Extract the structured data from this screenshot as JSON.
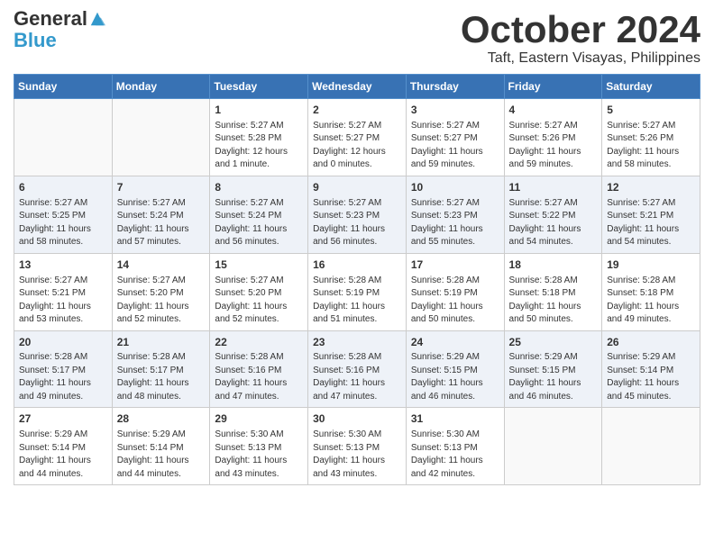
{
  "header": {
    "logo_general": "General",
    "logo_blue": "Blue",
    "month_title": "October 2024",
    "location": "Taft, Eastern Visayas, Philippines"
  },
  "days_of_week": [
    "Sunday",
    "Monday",
    "Tuesday",
    "Wednesday",
    "Thursday",
    "Friday",
    "Saturday"
  ],
  "weeks": [
    [
      {
        "day": "",
        "detail": ""
      },
      {
        "day": "",
        "detail": ""
      },
      {
        "day": "1",
        "detail": "Sunrise: 5:27 AM\nSunset: 5:28 PM\nDaylight: 12 hours\nand 1 minute."
      },
      {
        "day": "2",
        "detail": "Sunrise: 5:27 AM\nSunset: 5:27 PM\nDaylight: 12 hours\nand 0 minutes."
      },
      {
        "day": "3",
        "detail": "Sunrise: 5:27 AM\nSunset: 5:27 PM\nDaylight: 11 hours\nand 59 minutes."
      },
      {
        "day": "4",
        "detail": "Sunrise: 5:27 AM\nSunset: 5:26 PM\nDaylight: 11 hours\nand 59 minutes."
      },
      {
        "day": "5",
        "detail": "Sunrise: 5:27 AM\nSunset: 5:26 PM\nDaylight: 11 hours\nand 58 minutes."
      }
    ],
    [
      {
        "day": "6",
        "detail": "Sunrise: 5:27 AM\nSunset: 5:25 PM\nDaylight: 11 hours\nand 58 minutes."
      },
      {
        "day": "7",
        "detail": "Sunrise: 5:27 AM\nSunset: 5:24 PM\nDaylight: 11 hours\nand 57 minutes."
      },
      {
        "day": "8",
        "detail": "Sunrise: 5:27 AM\nSunset: 5:24 PM\nDaylight: 11 hours\nand 56 minutes."
      },
      {
        "day": "9",
        "detail": "Sunrise: 5:27 AM\nSunset: 5:23 PM\nDaylight: 11 hours\nand 56 minutes."
      },
      {
        "day": "10",
        "detail": "Sunrise: 5:27 AM\nSunset: 5:23 PM\nDaylight: 11 hours\nand 55 minutes."
      },
      {
        "day": "11",
        "detail": "Sunrise: 5:27 AM\nSunset: 5:22 PM\nDaylight: 11 hours\nand 54 minutes."
      },
      {
        "day": "12",
        "detail": "Sunrise: 5:27 AM\nSunset: 5:21 PM\nDaylight: 11 hours\nand 54 minutes."
      }
    ],
    [
      {
        "day": "13",
        "detail": "Sunrise: 5:27 AM\nSunset: 5:21 PM\nDaylight: 11 hours\nand 53 minutes."
      },
      {
        "day": "14",
        "detail": "Sunrise: 5:27 AM\nSunset: 5:20 PM\nDaylight: 11 hours\nand 52 minutes."
      },
      {
        "day": "15",
        "detail": "Sunrise: 5:27 AM\nSunset: 5:20 PM\nDaylight: 11 hours\nand 52 minutes."
      },
      {
        "day": "16",
        "detail": "Sunrise: 5:28 AM\nSunset: 5:19 PM\nDaylight: 11 hours\nand 51 minutes."
      },
      {
        "day": "17",
        "detail": "Sunrise: 5:28 AM\nSunset: 5:19 PM\nDaylight: 11 hours\nand 50 minutes."
      },
      {
        "day": "18",
        "detail": "Sunrise: 5:28 AM\nSunset: 5:18 PM\nDaylight: 11 hours\nand 50 minutes."
      },
      {
        "day": "19",
        "detail": "Sunrise: 5:28 AM\nSunset: 5:18 PM\nDaylight: 11 hours\nand 49 minutes."
      }
    ],
    [
      {
        "day": "20",
        "detail": "Sunrise: 5:28 AM\nSunset: 5:17 PM\nDaylight: 11 hours\nand 49 minutes."
      },
      {
        "day": "21",
        "detail": "Sunrise: 5:28 AM\nSunset: 5:17 PM\nDaylight: 11 hours\nand 48 minutes."
      },
      {
        "day": "22",
        "detail": "Sunrise: 5:28 AM\nSunset: 5:16 PM\nDaylight: 11 hours\nand 47 minutes."
      },
      {
        "day": "23",
        "detail": "Sunrise: 5:28 AM\nSunset: 5:16 PM\nDaylight: 11 hours\nand 47 minutes."
      },
      {
        "day": "24",
        "detail": "Sunrise: 5:29 AM\nSunset: 5:15 PM\nDaylight: 11 hours\nand 46 minutes."
      },
      {
        "day": "25",
        "detail": "Sunrise: 5:29 AM\nSunset: 5:15 PM\nDaylight: 11 hours\nand 46 minutes."
      },
      {
        "day": "26",
        "detail": "Sunrise: 5:29 AM\nSunset: 5:14 PM\nDaylight: 11 hours\nand 45 minutes."
      }
    ],
    [
      {
        "day": "27",
        "detail": "Sunrise: 5:29 AM\nSunset: 5:14 PM\nDaylight: 11 hours\nand 44 minutes."
      },
      {
        "day": "28",
        "detail": "Sunrise: 5:29 AM\nSunset: 5:14 PM\nDaylight: 11 hours\nand 44 minutes."
      },
      {
        "day": "29",
        "detail": "Sunrise: 5:30 AM\nSunset: 5:13 PM\nDaylight: 11 hours\nand 43 minutes."
      },
      {
        "day": "30",
        "detail": "Sunrise: 5:30 AM\nSunset: 5:13 PM\nDaylight: 11 hours\nand 43 minutes."
      },
      {
        "day": "31",
        "detail": "Sunrise: 5:30 AM\nSunset: 5:13 PM\nDaylight: 11 hours\nand 42 minutes."
      },
      {
        "day": "",
        "detail": ""
      },
      {
        "day": "",
        "detail": ""
      }
    ]
  ]
}
